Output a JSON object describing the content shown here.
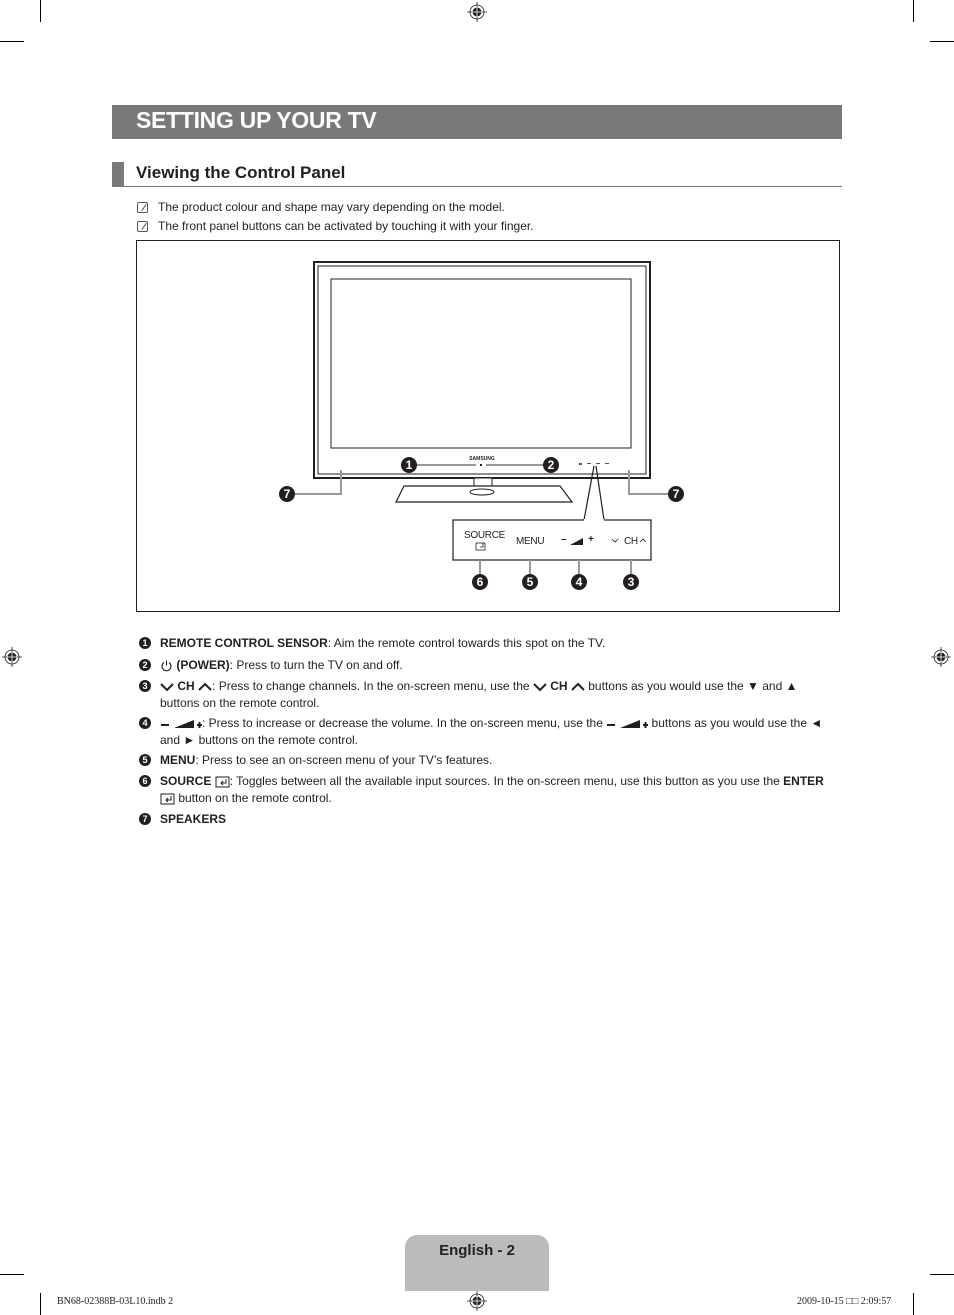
{
  "page": {
    "title": "SETTING UP YOUR TV",
    "section_heading": "Viewing the Control Panel",
    "notes": [
      "The product colour and shape may vary depending on the model.",
      "The front panel buttons can be activated by touching it with your finger."
    ]
  },
  "diagram": {
    "brand": "SAMSUNG",
    "callouts": [
      "1",
      "2",
      "3",
      "4",
      "5",
      "6",
      "7"
    ],
    "panel_buttons": {
      "source": "SOURCE",
      "menu": "MENU",
      "volume_minus": "–",
      "volume_plus": "+",
      "ch": "CH"
    }
  },
  "items": [
    {
      "num": "1",
      "bold": "REMOTE CONTROL SENSOR",
      "text": ": Aim the remote control towards this spot on the TV."
    },
    {
      "num": "2",
      "bold": "(POWER)",
      "text": ": Press to turn the TV on and off."
    },
    {
      "num": "3",
      "bold": "CH",
      "text_a": ": Press to change channels. In the on-screen menu, use the ",
      "bold2": "CH",
      "text_b": " buttons as you would use the ▼ and ▲ buttons on the remote control."
    },
    {
      "num": "4",
      "text_a": ": Press to increase or decrease the volume. In the on-screen menu, use the ",
      "text_b": " buttons as you would use the ◄ and ► buttons on the remote control."
    },
    {
      "num": "5",
      "bold": "MENU",
      "text": ": Press to see an on-screen menu of your TV’s features."
    },
    {
      "num": "6",
      "bold": "SOURCE",
      "text_a": ": Toggles between all the available input sources. In the on-screen menu, use this button as you use the ",
      "bold2": "ENTER",
      "text_b": " button on the remote control."
    },
    {
      "num": "7",
      "bold": "SPEAKERS"
    }
  ],
  "footer": {
    "page_label": "English - 2",
    "file_slug": "BN68-02388B-03L10.indb   2",
    "timestamp": "2009-10-15   □□ 2:09:57"
  }
}
